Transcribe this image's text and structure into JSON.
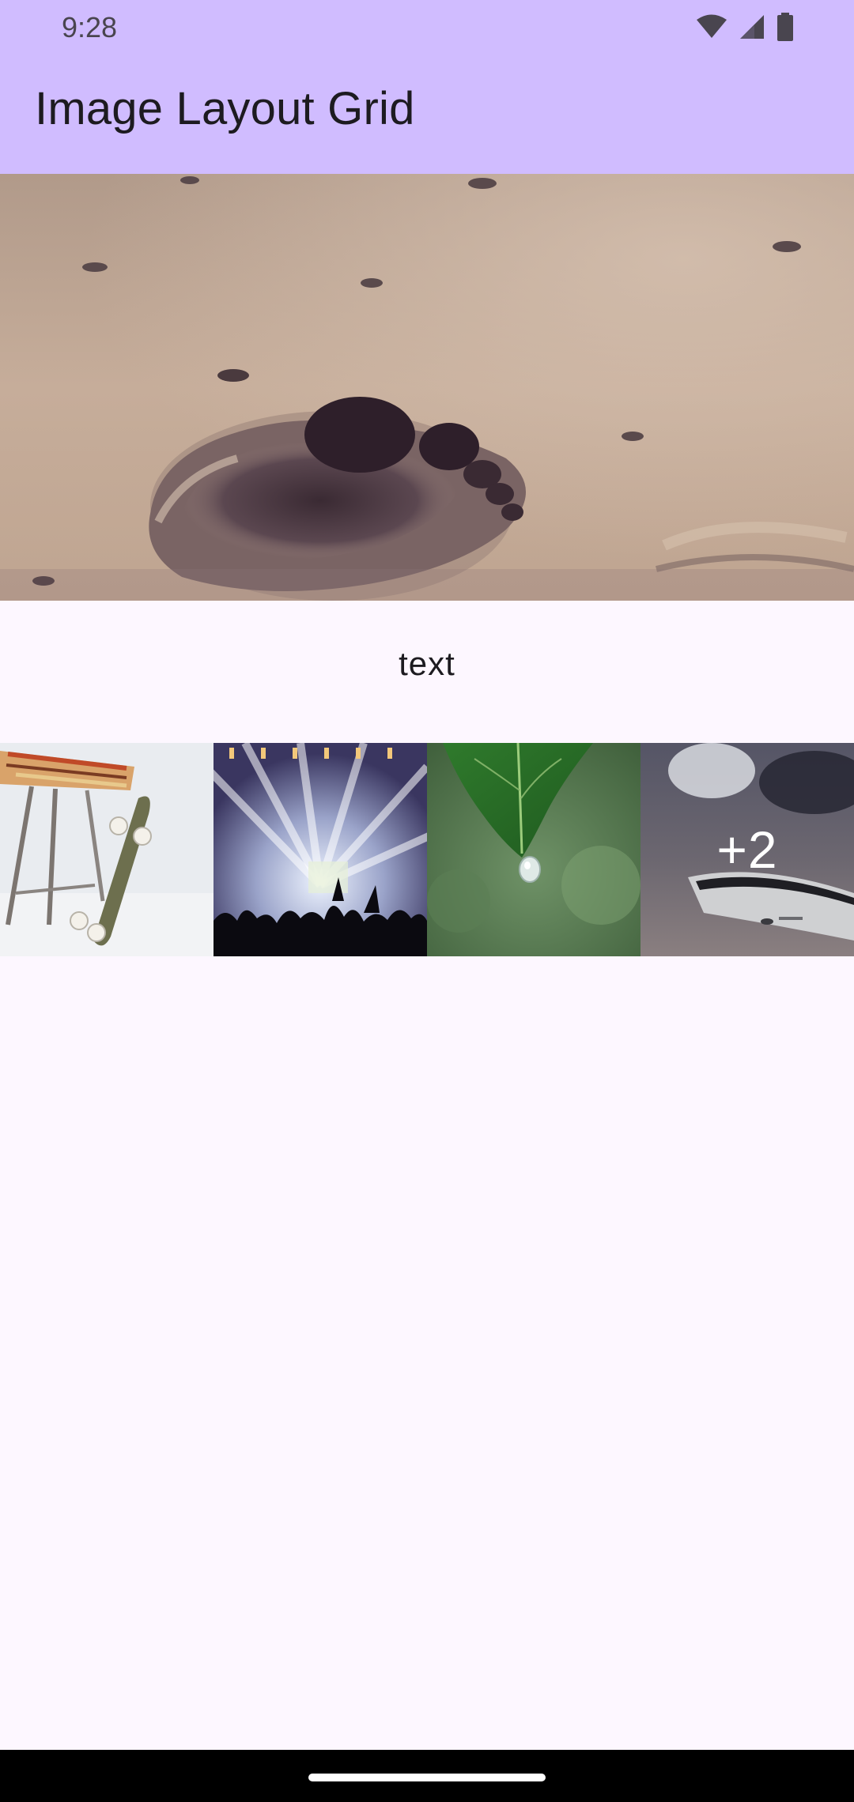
{
  "status_bar": {
    "time": "9:28",
    "icons": [
      "wifi-icon",
      "signal-icon",
      "battery-icon"
    ]
  },
  "app_bar": {
    "title": "Image Layout Grid",
    "background": "#d0bcff"
  },
  "hero_image": {
    "subject": "footprint in sand"
  },
  "caption": {
    "text": "text"
  },
  "thumbnails": [
    {
      "subject": "skateboard and stool"
    },
    {
      "subject": "concert stage lights"
    },
    {
      "subject": "leaf with water drop"
    },
    {
      "subject": "smartphone on table",
      "overlay_label": "+2"
    }
  ],
  "colors": {
    "surface": "#fdf7ff",
    "app_bar": "#d0bcff",
    "text_primary": "#1d1b20",
    "nav_bar": "#000000"
  }
}
